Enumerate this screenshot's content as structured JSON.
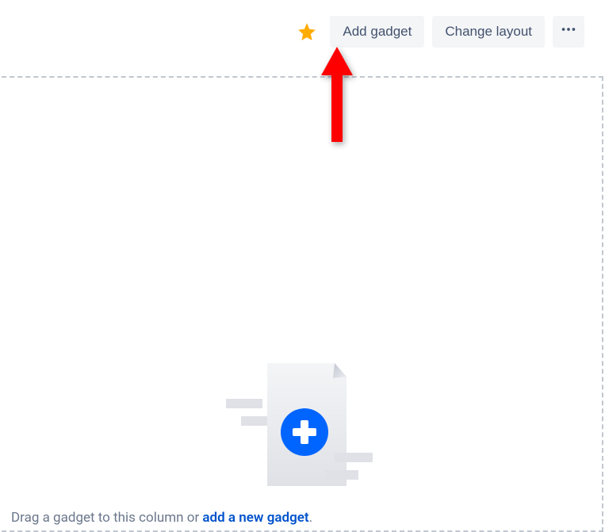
{
  "toolbar": {
    "star_icon": "star-icon",
    "add_gadget_label": "Add gadget",
    "change_layout_label": "Change layout",
    "more_icon": "more-icon"
  },
  "column": {
    "hint_prefix": "Drag a gadget to this column or ",
    "hint_link": "add a new gadget",
    "hint_suffix": "."
  },
  "colors": {
    "star": "#ffab00",
    "button_bg": "#f4f5f7",
    "button_text": "#42526e",
    "link": "#0052cc",
    "arrow": "#ff0000",
    "border_dash": "#c1c7d0",
    "badge_blue": "#0065ff"
  }
}
